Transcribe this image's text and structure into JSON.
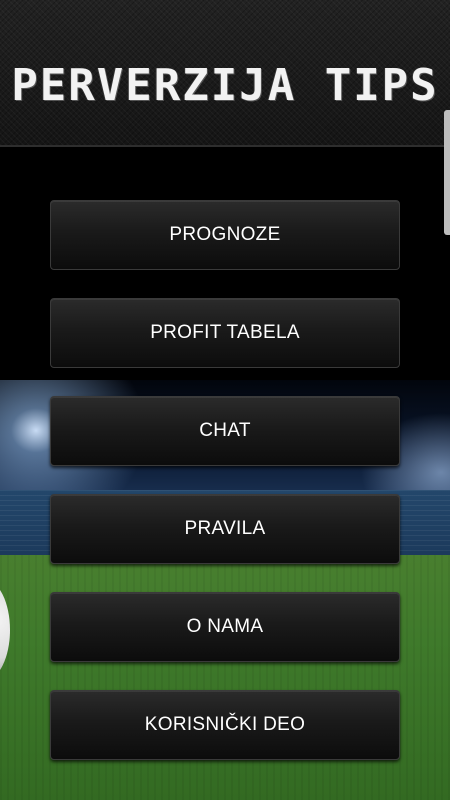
{
  "app": {
    "title": "PERVERZIJA TIPS"
  },
  "menu": {
    "items": [
      {
        "label": "PROGNOZE"
      },
      {
        "label": "PROFIT TABELA"
      },
      {
        "label": "CHAT"
      },
      {
        "label": "PRAVILA"
      },
      {
        "label": "O NAMA"
      },
      {
        "label": "KORISNIČKI DEO"
      }
    ]
  },
  "colors": {
    "header_bg": "#1c1c1c",
    "button_bg": "#1a1a1a",
    "button_text": "#ffffff",
    "grass": "#3f7a2b"
  }
}
